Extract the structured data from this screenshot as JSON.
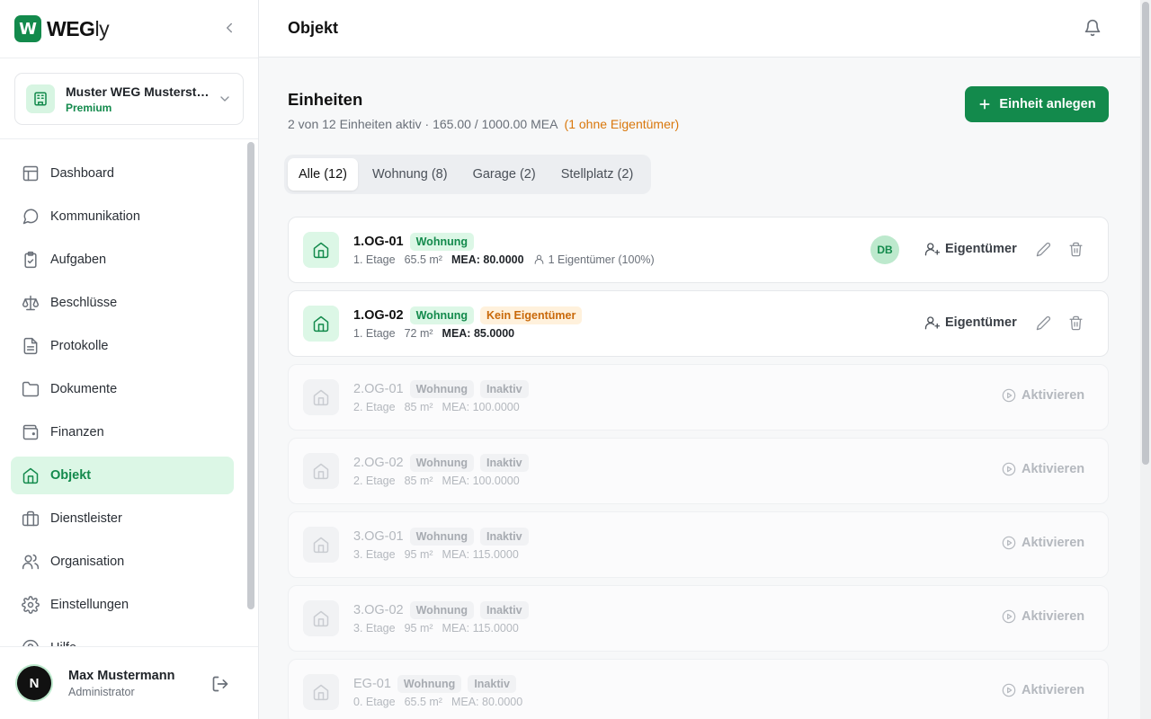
{
  "brand": {
    "mark": "W",
    "name": "WEG",
    "name_suffix": "ly"
  },
  "org": {
    "name": "Muster WEG Musterstraße",
    "plan": "Premium"
  },
  "nav": [
    {
      "label": "Dashboard",
      "icon": "dashboard-icon"
    },
    {
      "label": "Kommunikation",
      "icon": "chat-icon"
    },
    {
      "label": "Aufgaben",
      "icon": "clipboard-icon"
    },
    {
      "label": "Beschlüsse",
      "icon": "scale-icon"
    },
    {
      "label": "Protokolle",
      "icon": "document-icon"
    },
    {
      "label": "Dokumente",
      "icon": "folder-icon"
    },
    {
      "label": "Finanzen",
      "icon": "wallet-icon"
    },
    {
      "label": "Objekt",
      "icon": "house-icon",
      "active": true
    },
    {
      "label": "Dienstleister",
      "icon": "briefcase-icon"
    },
    {
      "label": "Organisation",
      "icon": "users-icon"
    },
    {
      "label": "Einstellungen",
      "icon": "gear-icon"
    },
    {
      "label": "Hilfe",
      "icon": "help-icon"
    }
  ],
  "user": {
    "initial": "N",
    "name": "Max Mustermann",
    "role": "Administrator"
  },
  "header": {
    "title": "Objekt"
  },
  "units_section": {
    "title": "Einheiten",
    "summary": "2 von 12 Einheiten aktiv · 165.00 / 1000.00 MEA",
    "warning": "(1 ohne Eigentümer)",
    "add_label": "Einheit anlegen"
  },
  "tabs": [
    {
      "label": "Alle (12)",
      "active": true
    },
    {
      "label": "Wohnung (8)"
    },
    {
      "label": "Garage (2)"
    },
    {
      "label": "Stellplatz (2)"
    }
  ],
  "labels": {
    "owner_button": "Eigentümer",
    "activate_button": "Aktivieren"
  },
  "units": [
    {
      "name": "1.OG-01",
      "type": "Wohnung",
      "floor": "1. Etage",
      "area": "65.5 m²",
      "mea": "MEA: 80.0000",
      "owners": "1 Eigentümer (100%)",
      "owner_initials": "DB",
      "active": true
    },
    {
      "name": "1.OG-02",
      "type": "Wohnung",
      "status": "Kein Eigentümer",
      "floor": "1. Etage",
      "area": "72 m²",
      "mea": "MEA: 85.0000",
      "active": true
    },
    {
      "name": "2.OG-01",
      "type": "Wohnung",
      "status": "Inaktiv",
      "floor": "2. Etage",
      "area": "85 m²",
      "mea": "MEA: 100.0000",
      "active": false
    },
    {
      "name": "2.OG-02",
      "type": "Wohnung",
      "status": "Inaktiv",
      "floor": "2. Etage",
      "area": "85 m²",
      "mea": "MEA: 100.0000",
      "active": false
    },
    {
      "name": "3.OG-01",
      "type": "Wohnung",
      "status": "Inaktiv",
      "floor": "3. Etage",
      "area": "95 m²",
      "mea": "MEA: 115.0000",
      "active": false
    },
    {
      "name": "3.OG-02",
      "type": "Wohnung",
      "status": "Inaktiv",
      "floor": "3. Etage",
      "area": "95 m²",
      "mea": "MEA: 115.0000",
      "active": false
    },
    {
      "name": "EG-01",
      "type": "Wohnung",
      "status": "Inaktiv",
      "floor": "0. Etage",
      "area": "65.5 m²",
      "mea": "MEA: 80.0000",
      "active": false
    }
  ],
  "colors": {
    "brand": "#138a4c",
    "brand_light": "#dcf7e6",
    "warning": "#d9770b"
  }
}
